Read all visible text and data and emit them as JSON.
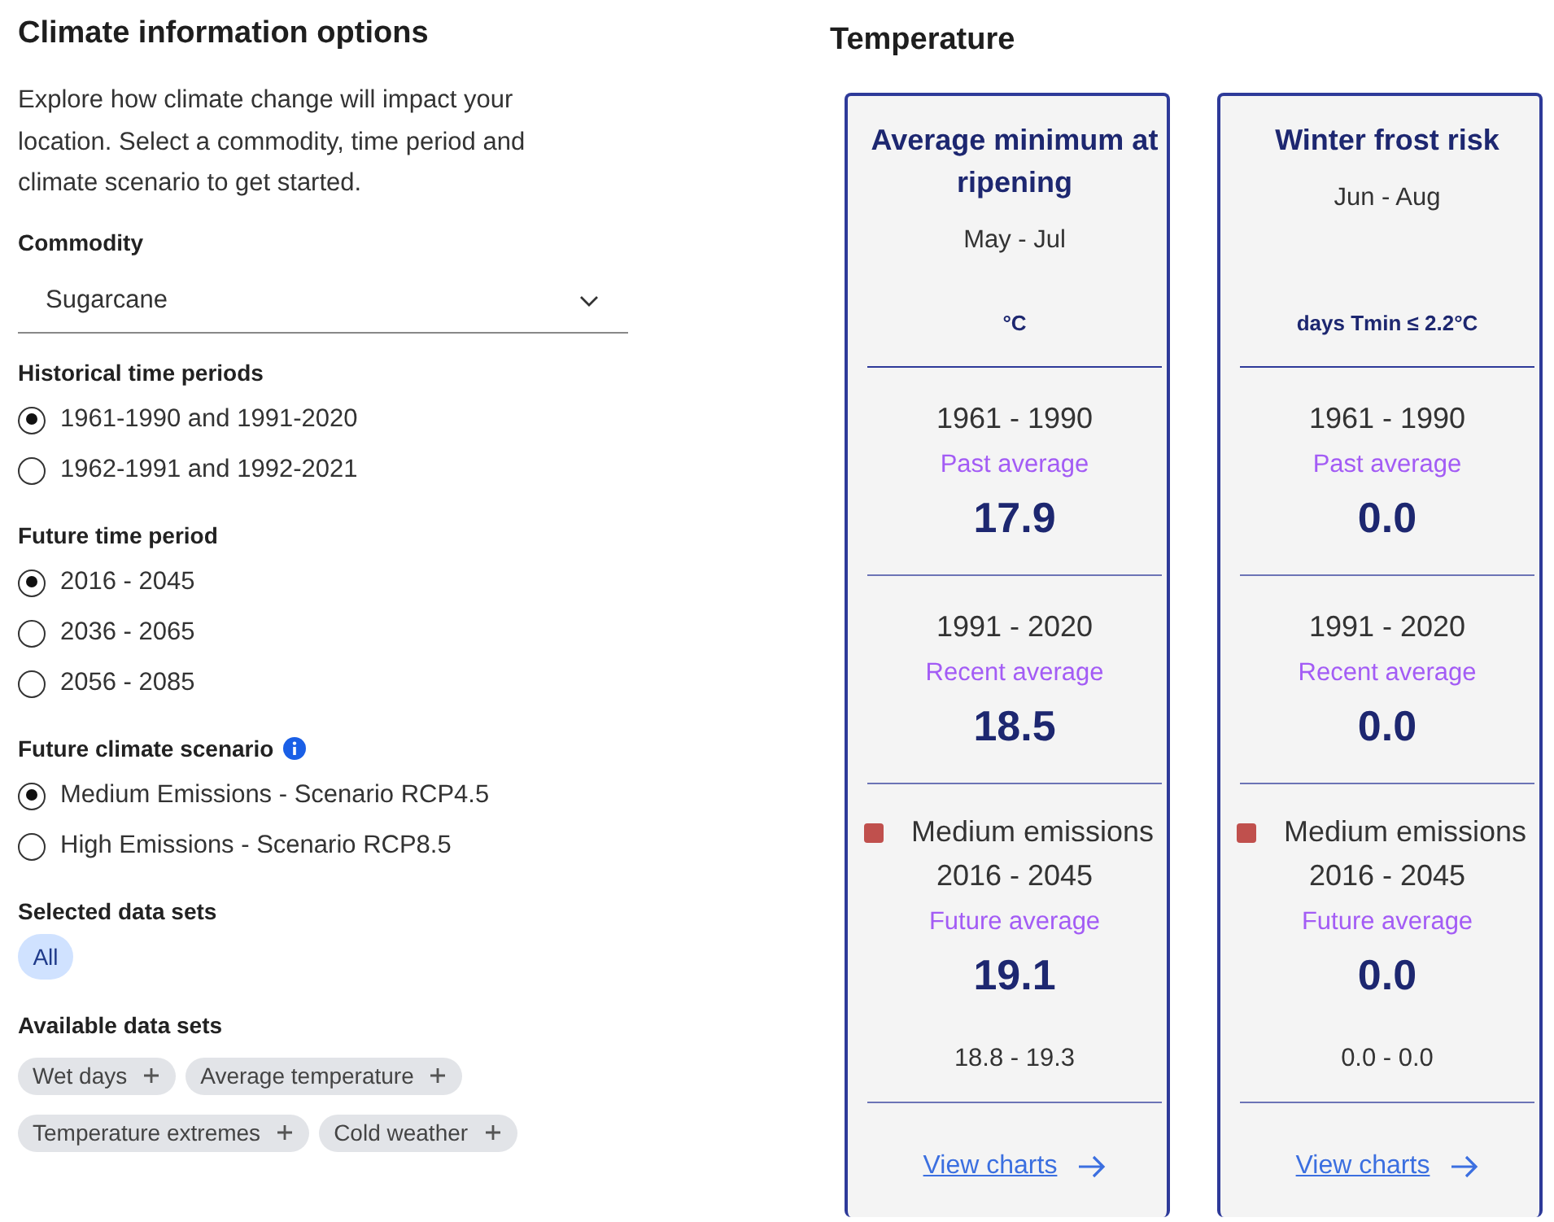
{
  "panel": {
    "title": "Climate information options",
    "intro": "Explore how climate change will impact your location. Select a commodity, time period and climate scenario to get started.",
    "commodity": {
      "label": "Commodity",
      "value": "Sugarcane"
    },
    "groups": [
      {
        "label": "Historical time periods",
        "options": [
          {
            "label": "1961-1990 and 1991-2020",
            "selected": true
          },
          {
            "label": "1962-1991 and 1992-2021",
            "selected": false
          }
        ]
      },
      {
        "label": "Future time period",
        "options": [
          {
            "label": "2016 - 2045",
            "selected": true
          },
          {
            "label": "2036 - 2065",
            "selected": false
          },
          {
            "label": "2056 - 2085",
            "selected": false
          }
        ]
      },
      {
        "label": "Future climate scenario",
        "has_info": true,
        "options": [
          {
            "label": "Medium Emissions - Scenario RCP4.5",
            "selected": true
          },
          {
            "label": "High Emissions - Scenario RCP8.5",
            "selected": false
          }
        ]
      }
    ],
    "selected_sets": {
      "label": "Selected data sets",
      "chips": [
        "All"
      ]
    },
    "available_sets": {
      "label": "Available data sets",
      "chips": [
        "Wet days",
        "Average temperature",
        "Temperature extremes",
        "Cold weather"
      ]
    }
  },
  "section": {
    "title": "Temperature",
    "cards": [
      {
        "title": "Average minimum at ripening",
        "months": "May - Jul",
        "unit": "°C",
        "periods": [
          {
            "kind": "past",
            "years": "1961 - 1990",
            "caption": "Past average",
            "value": "17.9"
          },
          {
            "kind": "recent",
            "years": "1991 - 2020",
            "caption": "Recent average",
            "value": "18.5"
          },
          {
            "kind": "future",
            "scenario": "Medium emissions",
            "color": "#c0504d",
            "years": "2016 - 2045",
            "caption": "Future average",
            "value": "19.1",
            "range": "18.8 - 19.3"
          }
        ],
        "link": "View charts"
      },
      {
        "title": "Winter frost risk",
        "months": "Jun - Aug",
        "unit": "days Tmin ≤ 2.2°C",
        "periods": [
          {
            "kind": "past",
            "years": "1961 - 1990",
            "caption": "Past average",
            "value": "0.0"
          },
          {
            "kind": "recent",
            "years": "1991 - 2020",
            "caption": "Recent average",
            "value": "0.0"
          },
          {
            "kind": "future",
            "scenario": "Medium emissions",
            "color": "#c0504d",
            "years": "2016 - 2045",
            "caption": "Future average",
            "value": "0.0",
            "range": "0.0 - 0.0"
          }
        ],
        "link": "View charts"
      }
    ]
  }
}
